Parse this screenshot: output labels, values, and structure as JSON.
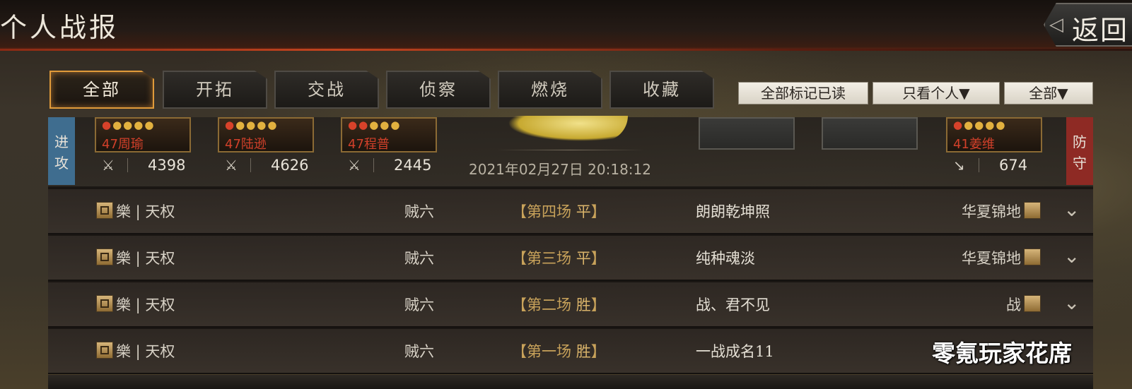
{
  "header": {
    "title": "个人战报",
    "back_label": "返回"
  },
  "tabs": [
    {
      "label": "全部",
      "active": true
    },
    {
      "label": "开拓",
      "active": false
    },
    {
      "label": "交战",
      "active": false
    },
    {
      "label": "侦察",
      "active": false
    },
    {
      "label": "燃烧",
      "active": false
    },
    {
      "label": "收藏",
      "active": false
    }
  ],
  "filters": {
    "mark_all_read": "全部标记已读",
    "only_personal": "只看个人▼",
    "all": "全部▼"
  },
  "battle": {
    "attack_label": [
      "进",
      "攻"
    ],
    "defend_label": [
      "防",
      "守"
    ],
    "attackers": [
      {
        "level": "47",
        "name": "周瑜",
        "troops": "4398"
      },
      {
        "level": "47",
        "name": "陆逊",
        "troops": "4626"
      },
      {
        "level": "47",
        "name": "程普",
        "troops": "2445"
      }
    ],
    "defenders": [
      {
        "level": "41",
        "name": "姜维",
        "troops": "674"
      }
    ],
    "datetime": "2021年02月27日  20:18:12"
  },
  "records": [
    {
      "my_name": "樂 | 天权",
      "my_player": "贼六",
      "round_text": "【第四场 ",
      "round_result": "平",
      "round_end": "】",
      "opp_player": "朗朗乾坤照",
      "opp_name": "华夏锦地"
    },
    {
      "my_name": "樂 | 天权",
      "my_player": "贼六",
      "round_text": "【第三场 ",
      "round_result": "平",
      "round_end": "】",
      "opp_player": "纯种魂淡",
      "opp_name": "华夏锦地"
    },
    {
      "my_name": "樂 | 天权",
      "my_player": "贼六",
      "round_text": "【第二场 ",
      "round_result": "胜",
      "round_end": "】",
      "opp_player": "战、君不见",
      "opp_name": "战"
    },
    {
      "my_name": "樂 | 天权",
      "my_player": "贼六",
      "round_text": "【第一场 ",
      "round_result": "胜",
      "round_end": "】",
      "opp_player": "一战成名11",
      "opp_name": ""
    }
  ],
  "watermark": "零氪玩家花席",
  "icons": {
    "attack": "crossed-swords-icon",
    "defense": "sword-down-icon",
    "expand": "chevron-down-icon"
  },
  "colors": {
    "tab_active_border": "#e19b3a",
    "attack_tag": "#3f6d8f",
    "defend_tag": "#8e2a24",
    "result_text": "#d9b36a"
  }
}
